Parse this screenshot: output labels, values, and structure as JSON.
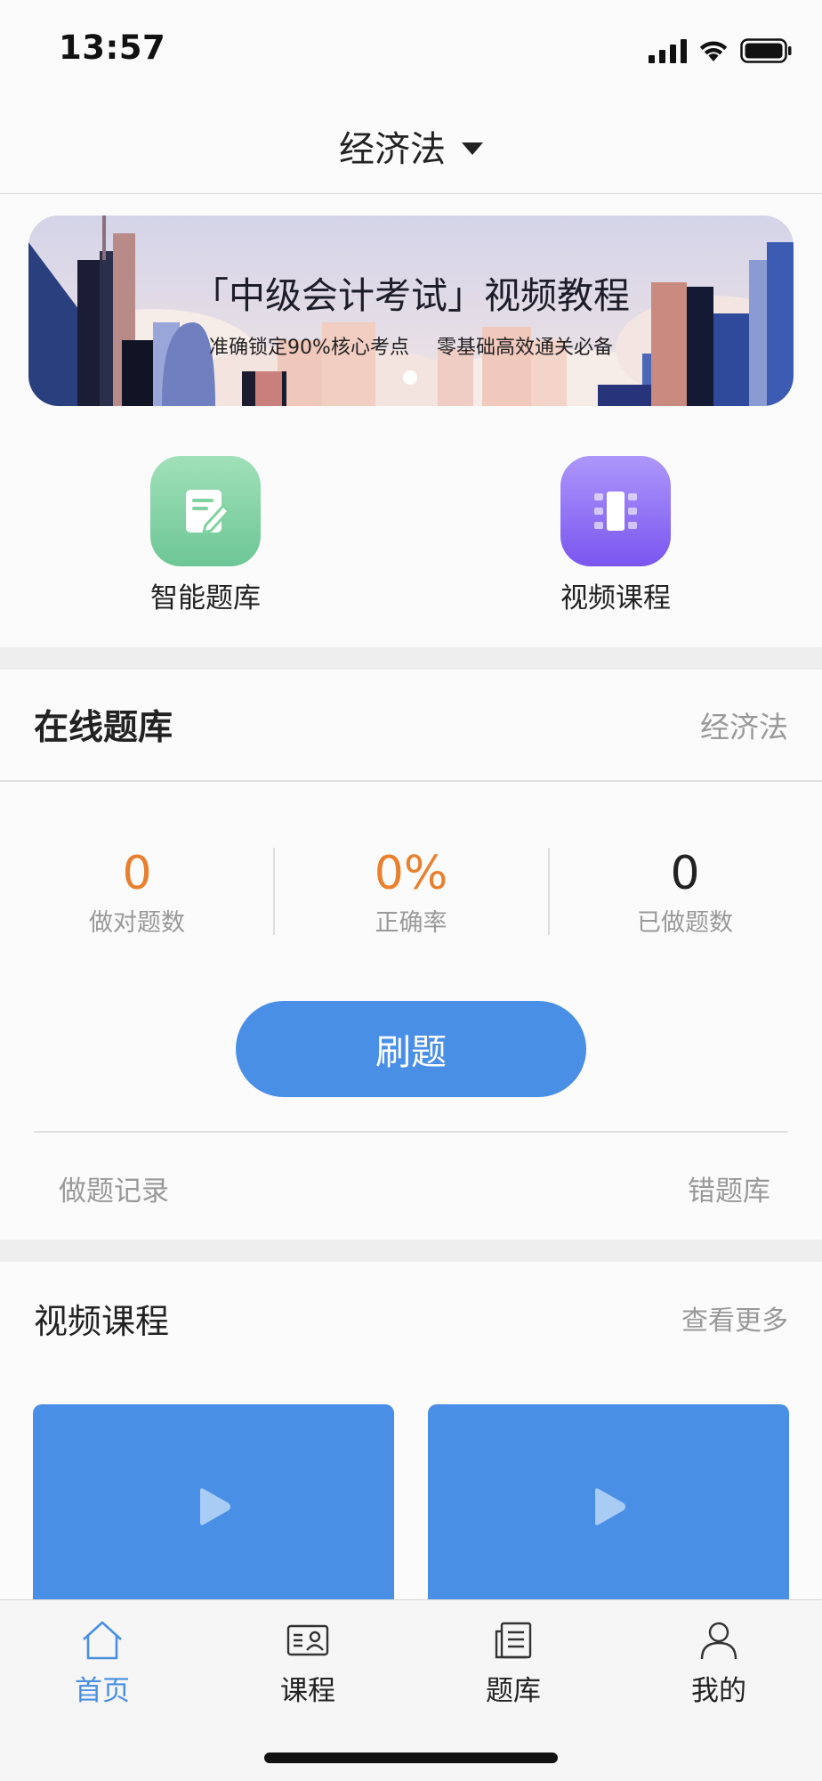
{
  "status_bar": {
    "time": "13:57"
  },
  "header": {
    "title": "经济法"
  },
  "banner": {
    "title": "「中级会计考试」视频教程",
    "subtitle": "准确锁定90%核心考点 零基础高效通关必备"
  },
  "quick_entries": [
    {
      "label": "智能题库",
      "icon": "note-edit-icon",
      "color": "#7fd3a1"
    },
    {
      "label": "视频课程",
      "icon": "film-icon",
      "color": "#8a6cf3"
    }
  ],
  "online_bank": {
    "title": "在线题库",
    "subject": "经济法",
    "stats": [
      {
        "value": "0",
        "label": "做对题数",
        "color": "#e9802f"
      },
      {
        "value": "0%",
        "label": "正确率",
        "color": "#e9802f"
      },
      {
        "value": "0",
        "label": "已做题数",
        "color": "#222222"
      }
    ],
    "practice_button": "刷题",
    "record_link": "做题记录",
    "wrong_link": "错题库"
  },
  "video_section": {
    "title": "视频课程",
    "more": "查看更多"
  },
  "tabbar": {
    "active_color": "#4a90e2",
    "items": [
      {
        "label": "首页",
        "icon": "home-icon",
        "active": true
      },
      {
        "label": "课程",
        "icon": "course-card-icon",
        "active": false
      },
      {
        "label": "题库",
        "icon": "question-bank-icon",
        "active": false
      },
      {
        "label": "我的",
        "icon": "profile-icon",
        "active": false
      }
    ]
  }
}
